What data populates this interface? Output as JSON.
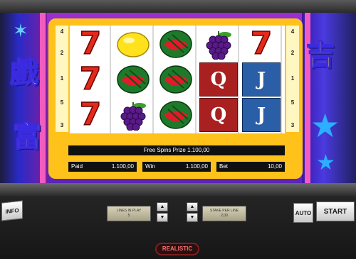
{
  "decor": {
    "left_kanji_top": "戲",
    "left_kanji_bottom": "富",
    "right_kanji": "吉",
    "emblem_icon": "dragon-emblem-icon",
    "star_icon": "star-icon"
  },
  "paylines": {
    "left": [
      "4",
      "2",
      "1",
      "5",
      "3"
    ],
    "right": [
      "4",
      "2",
      "1",
      "5",
      "3"
    ]
  },
  "reels": [
    [
      "seven",
      "seven",
      "seven"
    ],
    [
      "lemon",
      "watermelon",
      "grapes"
    ],
    [
      "watermelon",
      "watermelon",
      "watermelon"
    ],
    [
      "grapes",
      "queen",
      "queen"
    ],
    [
      "seven",
      "jack",
      "jack"
    ]
  ],
  "symbols": {
    "seven": "7",
    "queen": "Q",
    "jack": "J"
  },
  "info": {
    "prize_text": "Free Spins Prize 1.100,00",
    "paid_label": "Paid",
    "paid_value": "1.100,00",
    "win_label": "Win",
    "win_value": "1.100,00",
    "bet_label": "Bet",
    "bet_value": "10,00"
  },
  "controls": {
    "info_label": "INFO",
    "lines_label": "LINES IN PLAY",
    "lines_value": "5",
    "stake_label": "STAKE PER LINE",
    "stake_value": "2,00",
    "auto_label": "AUTO",
    "start_label": "START",
    "up_glyph": "▲",
    "down_glyph": "▼"
  },
  "brand": "REALISTIC",
  "colors": {
    "frame_gold": "#ffc21a",
    "seven_red": "#e22a1a",
    "side_purple": "#7a1fa0"
  }
}
